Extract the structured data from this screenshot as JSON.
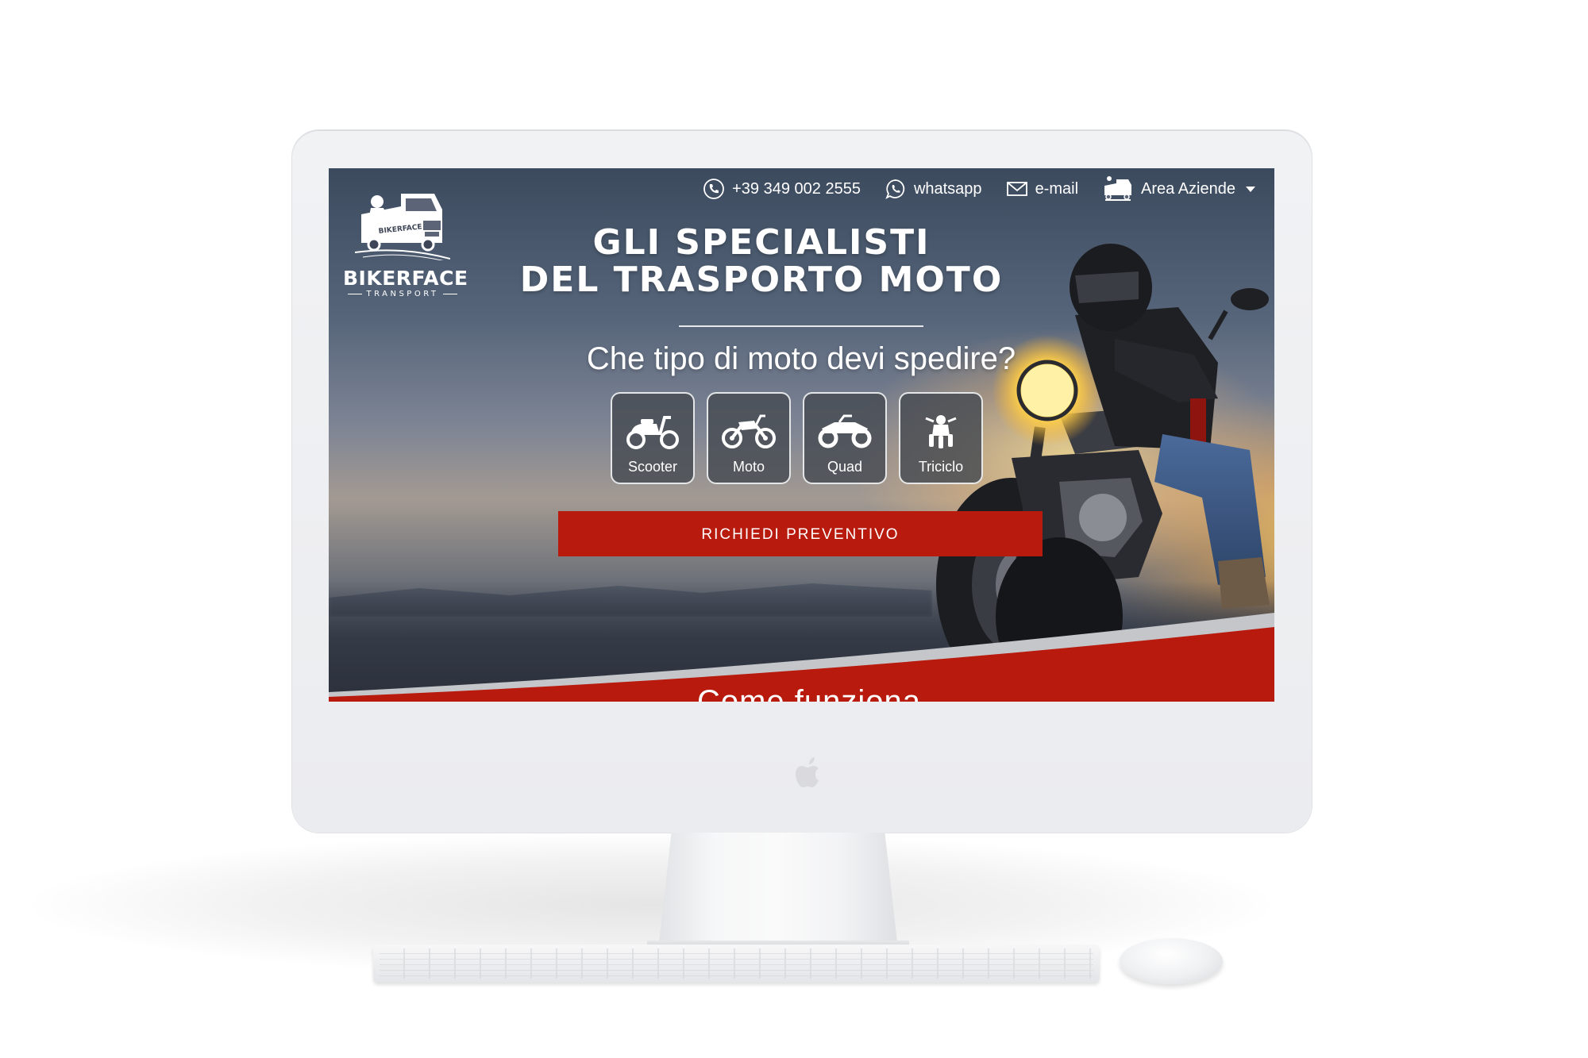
{
  "header": {
    "brand_name": "BIKERFACE",
    "brand_tagline": "TRANSPORT",
    "phone_label": "+39 349 002 2555",
    "whatsapp_label": "whatsapp",
    "email_label": "e-mail",
    "business_area_label": "Area Aziende"
  },
  "hero": {
    "title_line1": "GLI SPECIALISTI",
    "title_line2": "DEL TRASPORTO MOTO",
    "question": "Che tipo di moto devi spedire?",
    "vehicle_types": [
      {
        "label": "Scooter",
        "icon": "scooter-icon"
      },
      {
        "label": "Moto",
        "icon": "motorcycle-icon"
      },
      {
        "label": "Quad",
        "icon": "quad-icon"
      },
      {
        "label": "Triciclo",
        "icon": "trike-icon"
      }
    ],
    "cta_label": "RICHIEDI PREVENTIVO"
  },
  "next_section": {
    "title": "Come funziona"
  },
  "colors": {
    "accent_red": "#b81a0d",
    "tile_background": "#464a52",
    "text_light": "#ffffff"
  }
}
